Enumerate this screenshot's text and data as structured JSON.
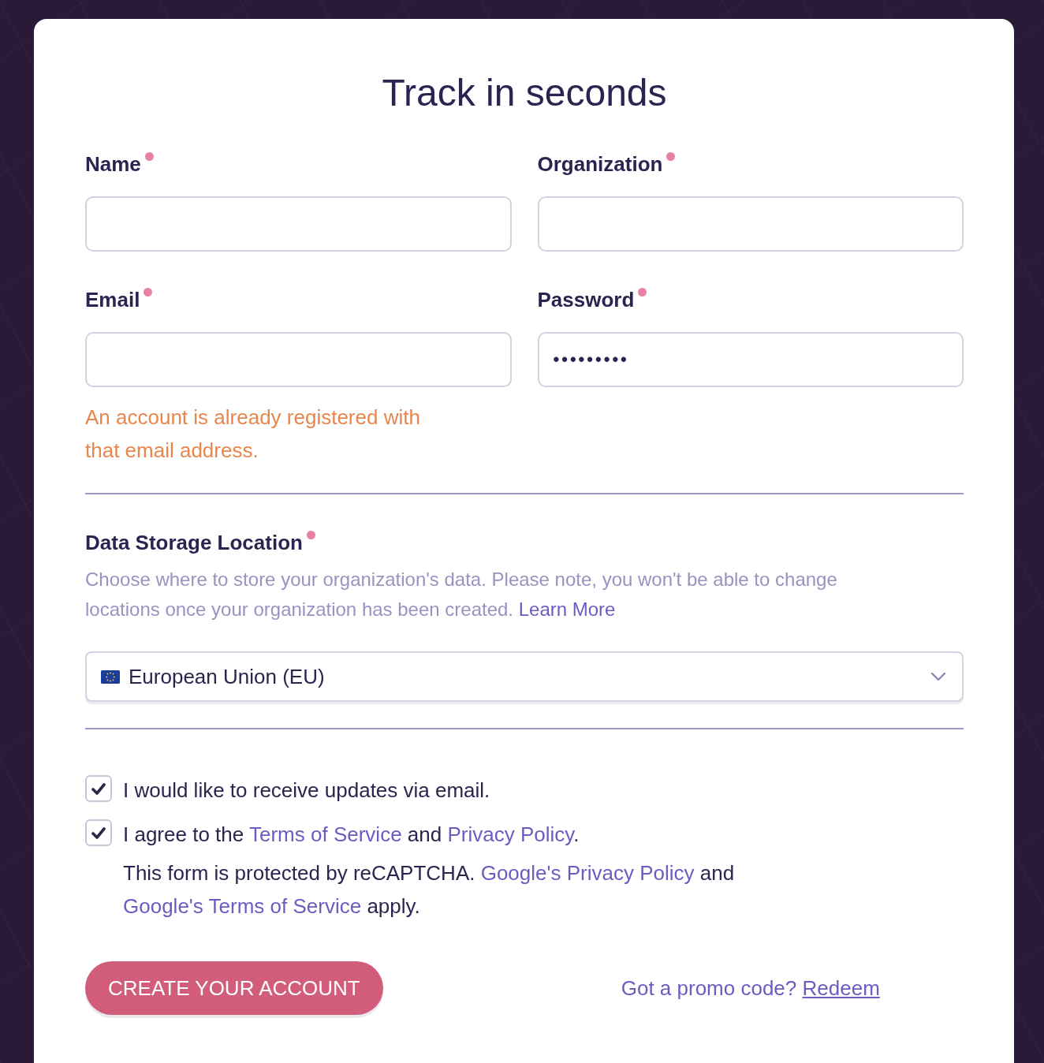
{
  "form": {
    "title": "Track in seconds",
    "fields": [
      {
        "label": "Name",
        "required": true
      },
      {
        "label": "Organization",
        "required": true
      },
      {
        "label": "Email",
        "required": true,
        "error": "An account is already registered with that email address."
      },
      {
        "label": "Password",
        "required": true,
        "value": "•••••••••"
      }
    ],
    "storage": {
      "label": "Data Storage Location",
      "required": true,
      "help": [
        {
          "kind": "text",
          "text": "Choose where to store your organization's data. Please note, you won't be able to change locations once your organization has been created. "
        },
        {
          "kind": "link",
          "text": "Learn More"
        }
      ],
      "select": {
        "value": "European Union (EU)"
      }
    },
    "checkboxes": [
      {
        "checked": true,
        "parts": [
          {
            "kind": "text",
            "text": "I would like to receive updates via email."
          }
        ]
      },
      {
        "checked": true,
        "parts": [
          {
            "kind": "text",
            "text": "I agree to the "
          },
          {
            "kind": "link",
            "text": "Terms of Service"
          },
          {
            "kind": "text",
            "text": " and "
          },
          {
            "kind": "link",
            "text": "Privacy Policy"
          },
          {
            "kind": "text",
            "text": "."
          }
        ]
      }
    ],
    "recaptcha_note": [
      {
        "kind": "text",
        "text": "This form is protected by reCAPTCHA. "
      },
      {
        "kind": "link",
        "text": "Google's Privacy Policy"
      },
      {
        "kind": "text",
        "text": " and "
      },
      {
        "kind": "link",
        "text": "Google's Terms of Service"
      },
      {
        "kind": "text",
        "text": " apply."
      }
    ],
    "submit": "CREATE YOUR ACCOUNT",
    "promo": [
      {
        "kind": "text",
        "text": "Got a promo code? "
      },
      {
        "kind": "underlined_link",
        "text": "Redeem"
      }
    ]
  }
}
